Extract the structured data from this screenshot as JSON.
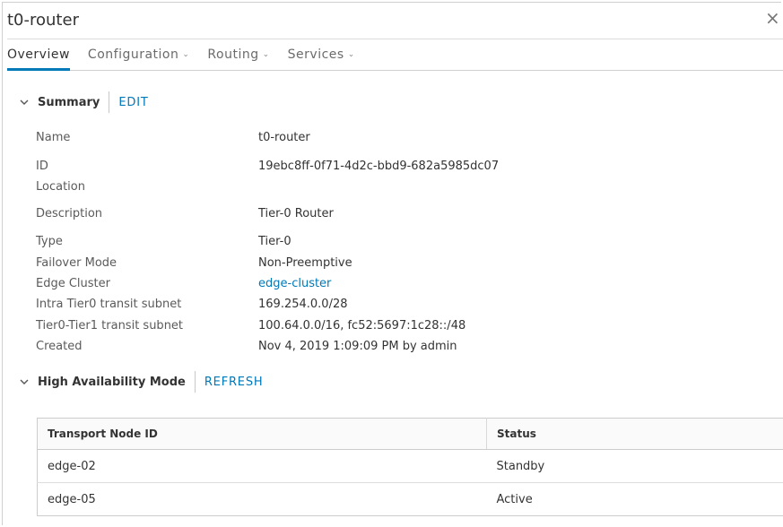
{
  "window": {
    "title": "t0-router",
    "close_icon": "×"
  },
  "tabs": [
    {
      "label": "Overview",
      "active": true,
      "has_dropdown": false
    },
    {
      "label": "Configuration",
      "active": false,
      "has_dropdown": true
    },
    {
      "label": "Routing",
      "active": false,
      "has_dropdown": true
    },
    {
      "label": "Services",
      "active": false,
      "has_dropdown": true
    }
  ],
  "summary": {
    "title": "Summary",
    "action": "EDIT",
    "fields": [
      {
        "label": "Name",
        "value": "t0-router"
      },
      {
        "label": "ID",
        "value": "19ebc8ff-0f71-4d2c-bbd9-682a5985dc07"
      },
      {
        "label": "Location",
        "value": ""
      },
      {
        "label": "Description",
        "value": "Tier-0 Router"
      },
      {
        "label": "Type",
        "value": "Tier-0"
      },
      {
        "label": "Failover Mode",
        "value": "Non-Preemptive"
      },
      {
        "label": "Edge Cluster",
        "value": "edge-cluster",
        "is_link": true
      },
      {
        "label": "Intra Tier0 transit subnet",
        "value": "169.254.0.0/28"
      },
      {
        "label": "Tier0-Tier1 transit subnet",
        "value": "100.64.0.0/16, fc52:5697:1c28::/48"
      },
      {
        "label": "Created",
        "value": "Nov 4, 2019 1:09:09 PM by admin"
      }
    ]
  },
  "ha": {
    "title": "High Availability Mode",
    "action": "REFRESH",
    "columns": [
      "Transport Node ID",
      "Status"
    ],
    "rows": [
      {
        "node": "edge-02",
        "status": "Standby"
      },
      {
        "node": "edge-05",
        "status": "Active"
      }
    ]
  },
  "colors": {
    "accent": "#0079b8",
    "text": "#333333",
    "muted": "#5a5a5a"
  },
  "icons": {
    "collapse": "chevron-down-icon",
    "close": "close-icon",
    "tab_dropdown": "chevron-down-icon"
  }
}
